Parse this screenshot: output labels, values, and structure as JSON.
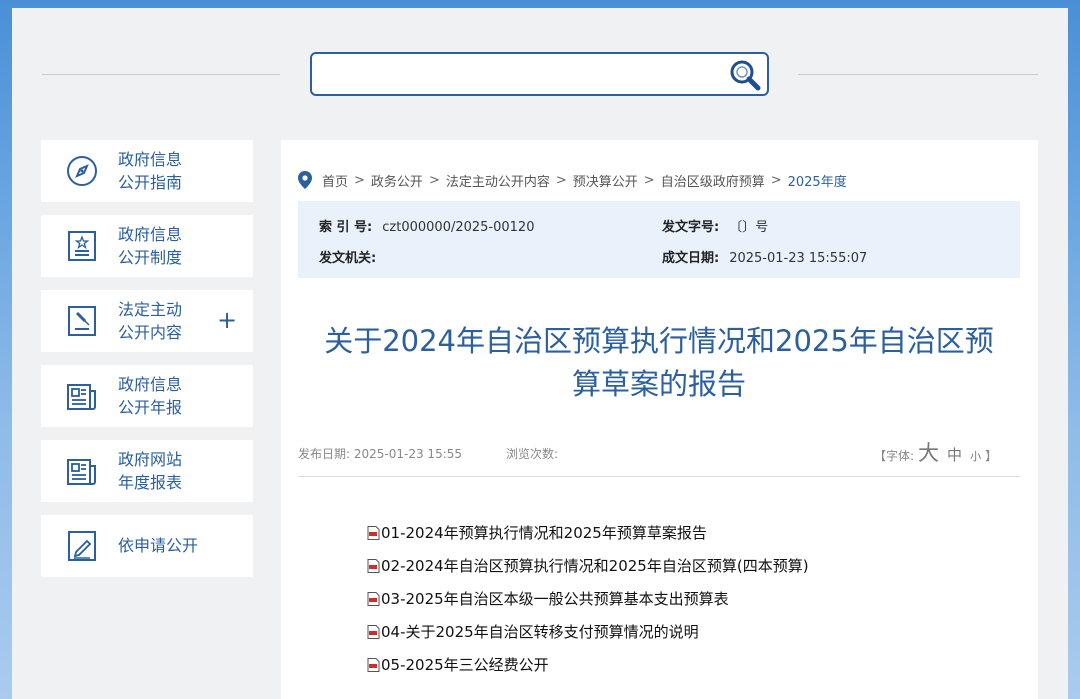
{
  "search": {
    "placeholder": "",
    "value": ""
  },
  "sidebar": {
    "items": [
      {
        "line1": "政府信息",
        "line2": "公开指南",
        "icon": "compass-icon"
      },
      {
        "line1": "政府信息",
        "line2": "公开制度",
        "icon": "regulation-icon"
      },
      {
        "line1": "法定主动",
        "line2": "公开内容",
        "icon": "gavel-icon",
        "expand": "+"
      },
      {
        "line1": "政府信息",
        "line2": "公开年报",
        "icon": "newspaper-icon"
      },
      {
        "line1": "政府网站",
        "line2": "年度报表",
        "icon": "report-icon"
      },
      {
        "line1": "依申请公开",
        "icon": "edit-icon"
      }
    ]
  },
  "breadcrumb": {
    "items": [
      "首页",
      "政务公开",
      "法定主动公开内容",
      "预决算公开",
      "自治区级政府预算",
      "2025年度"
    ],
    "separator": ">"
  },
  "meta": {
    "index_label": "索 引 号:",
    "index_value": "czt000000/2025-00120",
    "doc_no_label": "发文字号:",
    "doc_no_value": "〔〕号",
    "issuer_label": "发文机关:",
    "issuer_value": "",
    "date_label": "成文日期:",
    "date_value": "2025-01-23 15:55:07"
  },
  "title": {
    "line1": "关于2024年自治区预算执行情况和2025年自治区预",
    "line2": "算草案的报告"
  },
  "publish": {
    "date_label": "发布日期:",
    "date_value": "2025-01-23 15:55",
    "views_label": "浏览次数:",
    "views_value": "",
    "font_open": "【字体:",
    "font_big": "大",
    "font_mid": "中",
    "font_small": "小",
    "font_close": "】"
  },
  "attachments": [
    "01-2024年预算执行情况和2025年预算草案报告",
    "02-2024年自治区预算执行情况和2025年自治区预算(四本预算)",
    "03-2025年自治区本级一般公共预算基本支出预算表",
    "04-关于2025年自治区转移支付预算情况的说明",
    "05-2025年三公经费公开"
  ],
  "colors": {
    "accent": "#2b5f9e",
    "meta_bg": "#e9f1fb",
    "panel_bg": "#f0f1f3"
  }
}
